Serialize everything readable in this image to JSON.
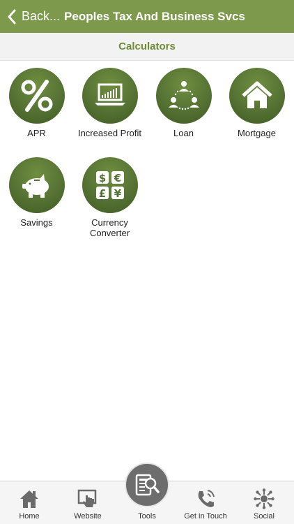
{
  "header": {
    "back_label": "Back...",
    "title": "Peoples Tax And Business Svcs"
  },
  "section": {
    "title": "Calculators"
  },
  "calculators": [
    {
      "label": "APR",
      "icon": "percent-icon"
    },
    {
      "label": "Increased Profit",
      "icon": "laptop-chart-icon"
    },
    {
      "label": "Loan",
      "icon": "people-network-icon"
    },
    {
      "label": "Mortgage",
      "icon": "house-icon"
    },
    {
      "label": "Savings",
      "icon": "piggy-bank-icon"
    },
    {
      "label": "Currency\nConverter",
      "icon": "currency-icon"
    }
  ],
  "tabs": [
    {
      "label": "Home",
      "icon": "home-icon"
    },
    {
      "label": "Website",
      "icon": "cursor-hand-icon"
    },
    {
      "label": "Tools",
      "icon": "tools-icon"
    },
    {
      "label": "Get in Touch",
      "icon": "phone-icon"
    },
    {
      "label": "Social",
      "icon": "social-network-icon"
    }
  ],
  "colors": {
    "header": "#7d9a4c",
    "accent": "#6e8c35",
    "tile": "#557234",
    "tab_icon": "#6b6b6b"
  }
}
